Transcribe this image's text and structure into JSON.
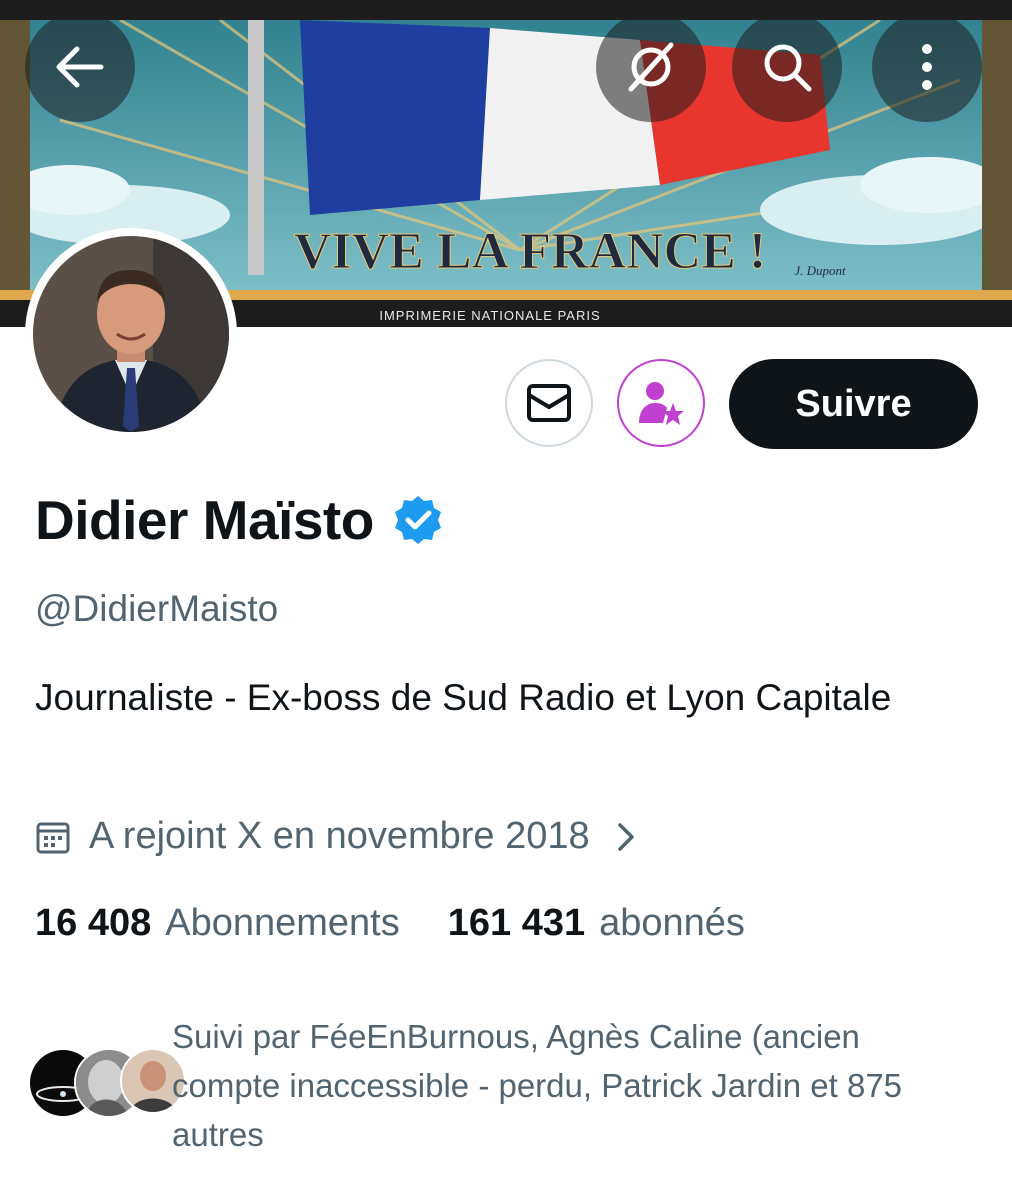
{
  "banner": {
    "headline": "VIVE LA FRANCE !",
    "printer": "IMPRIMERIE NATIONALE PARIS",
    "signature": "J. Dupont"
  },
  "top_bar": {
    "icons": [
      "back-arrow-icon",
      "grok-icon",
      "search-icon",
      "more-vertical-icon"
    ]
  },
  "actions": {
    "message_icon": "envelope-icon",
    "subscribe_icon": "person-star-icon",
    "subscribe_color": "#c13fd1",
    "follow_label": "Suivre"
  },
  "profile": {
    "name": "Didier Maïsto",
    "verified": true,
    "verified_color": "#1d9bf0",
    "handle": "@DidierMaisto",
    "bio": "Journaliste - Ex-boss de Sud Radio et Lyon Capitale",
    "joined": "A rejoint X en novembre 2018"
  },
  "stats": {
    "following_count": "16 408",
    "following_label": "Abonnements",
    "followers_count": "161 431",
    "followers_label": "abonnés"
  },
  "followed_by": {
    "text": "Suivi par FéeEnBurnous, Agnès Caline (ancien compte inaccessible - perdu, Patrick Jardin et 875 autres"
  }
}
